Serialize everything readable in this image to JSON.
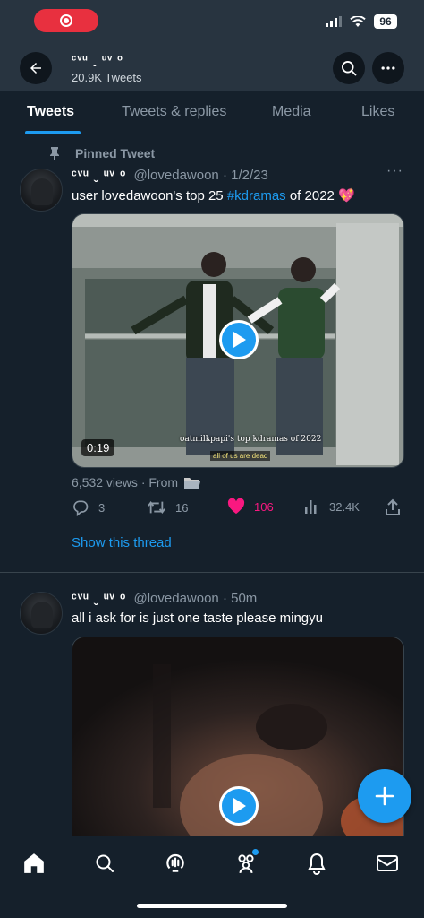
{
  "status_bar": {
    "battery": "96"
  },
  "header": {
    "title": "ᶜᵛᵘ ˬ ᵘᵛ ᵒ",
    "subtitle": "20.9K Tweets"
  },
  "tabs": [
    {
      "label": "Tweets"
    },
    {
      "label": "Tweets & replies"
    },
    {
      "label": "Media"
    },
    {
      "label": "Likes"
    }
  ],
  "tweets": [
    {
      "pinned_label": "Pinned Tweet",
      "display_name": "ᶜᵛᵘ ˬ ᵘᵛ ᵒ",
      "handle_time": "@lovedawoon · 1/2/23",
      "text_before": "user lovedawoon's top 25 ",
      "hashtag": "#kdramas",
      "text_after": " of 2022 💖",
      "media_caption": "oatmilkpapi's top kdramas of 2022",
      "media_subtitle": "all of us are dead",
      "duration": "0:19",
      "views": "6,532 views · From",
      "replies": "3",
      "retweets": "16",
      "likes": "106",
      "analytics": "32.4K",
      "show_thread": "Show this thread"
    },
    {
      "display_name": "ᶜᵛᵘ ˬ ᵘᵛ ᵒ",
      "handle_time": "@lovedawoon · 50m",
      "text": "all i ask for is just one taste please mingyu"
    }
  ],
  "icons": {
    "back": "arrow-left-icon",
    "search": "search-icon",
    "more": "more-horizontal-icon",
    "pin": "pin-icon",
    "reply": "reply-icon",
    "retweet": "retweet-icon",
    "like": "heart-icon",
    "analytics": "analytics-icon",
    "share": "share-icon",
    "compose": "plus-icon"
  },
  "colors": {
    "background": "#15202b",
    "accent": "#1d9bf0",
    "like": "#f91880",
    "header_bg": "#283440"
  }
}
